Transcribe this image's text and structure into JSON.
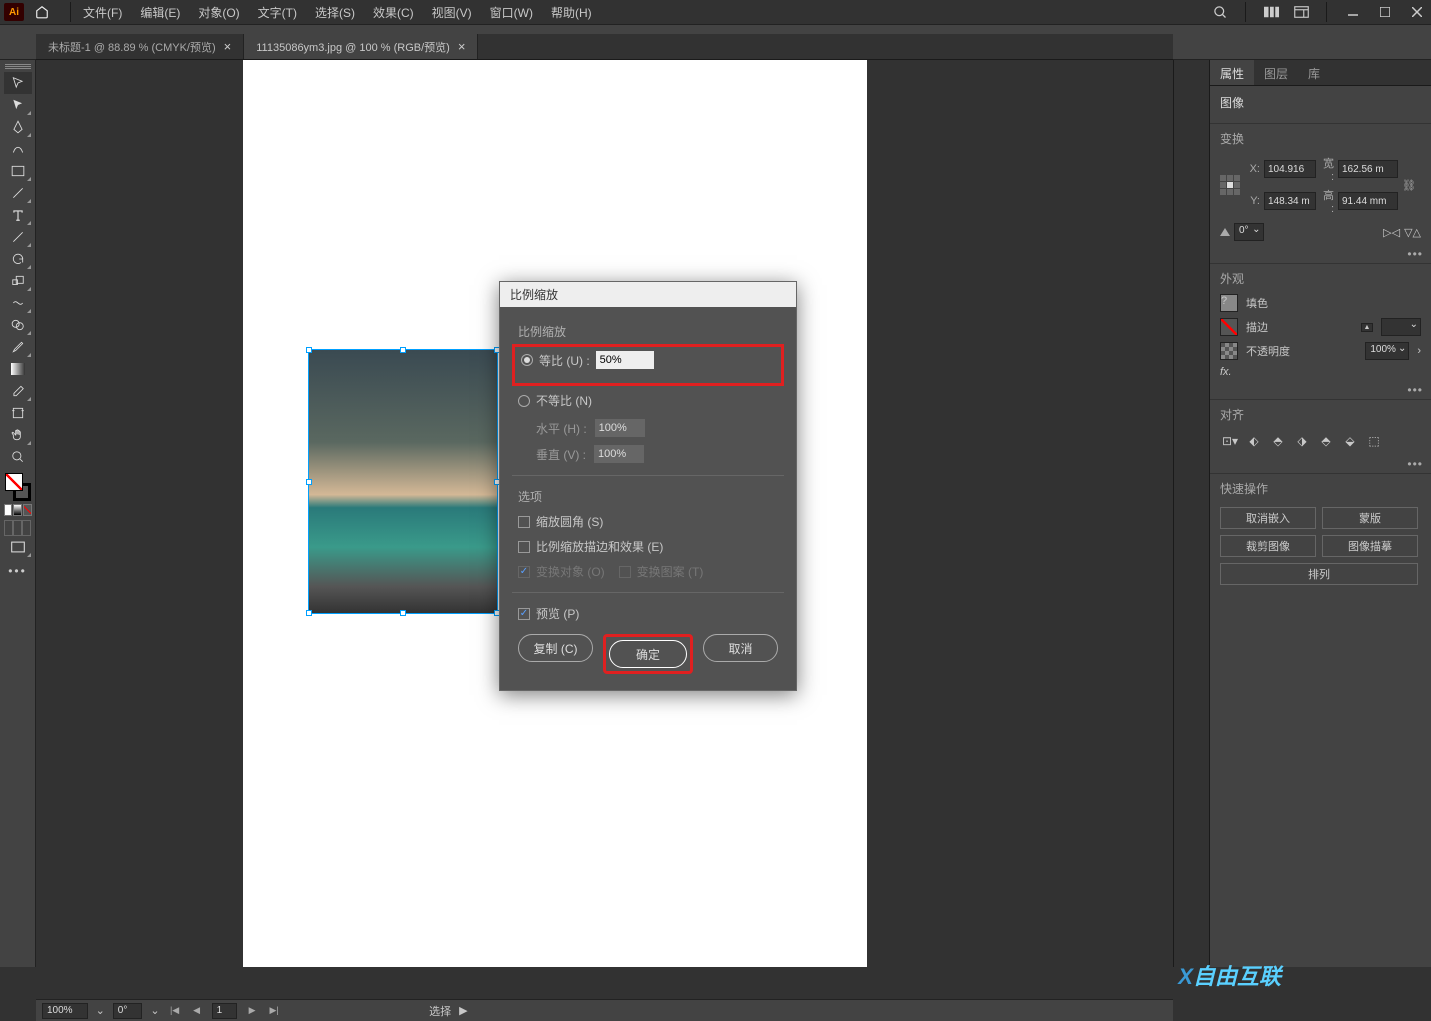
{
  "menu": {
    "file": "文件(F)",
    "edit": "编辑(E)",
    "object": "对象(O)",
    "text": "文字(T)",
    "select": "选择(S)",
    "effect": "效果(C)",
    "view": "视图(V)",
    "window": "窗口(W)",
    "help": "帮助(H)"
  },
  "tabs": {
    "tab1": "未标题-1 @ 88.89 % (CMYK/预览)",
    "tab2": "11135086ym3.jpg @ 100 % (RGB/预览)"
  },
  "dialog": {
    "title": "比例缩放",
    "section_scale": "比例缩放",
    "uniform": "等比 (U) :",
    "uniform_val": "50%",
    "nonuniform": "不等比 (N)",
    "horiz": "水平 (H) :",
    "horiz_val": "100%",
    "vert": "垂直 (V) :",
    "vert_val": "100%",
    "options": "选项",
    "scale_corners": "缩放圆角 (S)",
    "scale_strokes": "比例缩放描边和效果 (E)",
    "transform_obj": "变换对象 (O)",
    "transform_pat": "变换图案 (T)",
    "preview": "预览 (P)",
    "copy": "复制 (C)",
    "ok": "确定",
    "cancel": "取消"
  },
  "panels": {
    "properties": "属性",
    "layers": "图层",
    "libraries": "库",
    "image": "图像",
    "transform": "变换",
    "x_label": "X:",
    "x": "104.916",
    "y_label": "Y:",
    "y": "148.34 m",
    "w_label": "宽 :",
    "w": "162.56 m",
    "h_label": "高 :",
    "h": "91.44 mm",
    "angle": "0°",
    "appearance": "外观",
    "fill": "填色",
    "stroke": "描边",
    "opacity": "不透明度",
    "opacity_val": "100%",
    "fx": "fx.",
    "align": "对齐",
    "quick_actions": "快速操作",
    "unembed": "取消嵌入",
    "mask": "蒙版",
    "crop": "裁剪图像",
    "trace": "图像描摹",
    "arrange": "排列"
  },
  "statusbar": {
    "zoom": "100%",
    "rotate": "0°",
    "artboard": "1",
    "mode": "选择"
  },
  "watermark": "自由互联"
}
